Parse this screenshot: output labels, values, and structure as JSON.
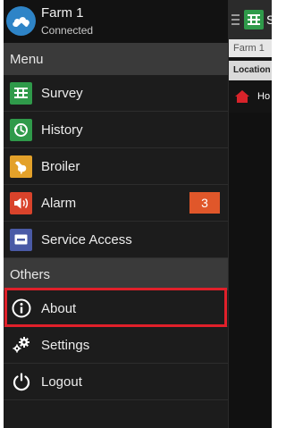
{
  "header": {
    "farm_name": "Farm 1",
    "status": "Connected",
    "logo_icon": "cloud-farm-icon"
  },
  "sections": {
    "menu": "Menu",
    "others": "Others"
  },
  "menu_items": [
    {
      "label": "Survey",
      "icon": "grid-icon",
      "color": "#2f9a4a"
    },
    {
      "label": "History",
      "icon": "clock-history-icon",
      "color": "#2f9a4a"
    },
    {
      "label": "Broiler",
      "icon": "chicken-icon",
      "color": "#e3a12a"
    },
    {
      "label": "Alarm",
      "icon": "speaker-alarm-icon",
      "color": "#d9432b",
      "badge": "3"
    },
    {
      "label": "Service Access",
      "icon": "service-card-icon",
      "color": "#4a5aa6"
    }
  ],
  "other_items": [
    {
      "label": "About",
      "icon": "info-icon"
    },
    {
      "label": "Settings",
      "icon": "gears-icon"
    },
    {
      "label": "Logout",
      "icon": "power-icon"
    }
  ],
  "behind": {
    "toolbar_fragment": "S",
    "crumb": "Farm 1",
    "column_header": "Location",
    "row_text": "Ho"
  },
  "colors": {
    "badge": "#e0572a",
    "highlight": "#e0202a",
    "section_bg": "#3a3a3a"
  }
}
